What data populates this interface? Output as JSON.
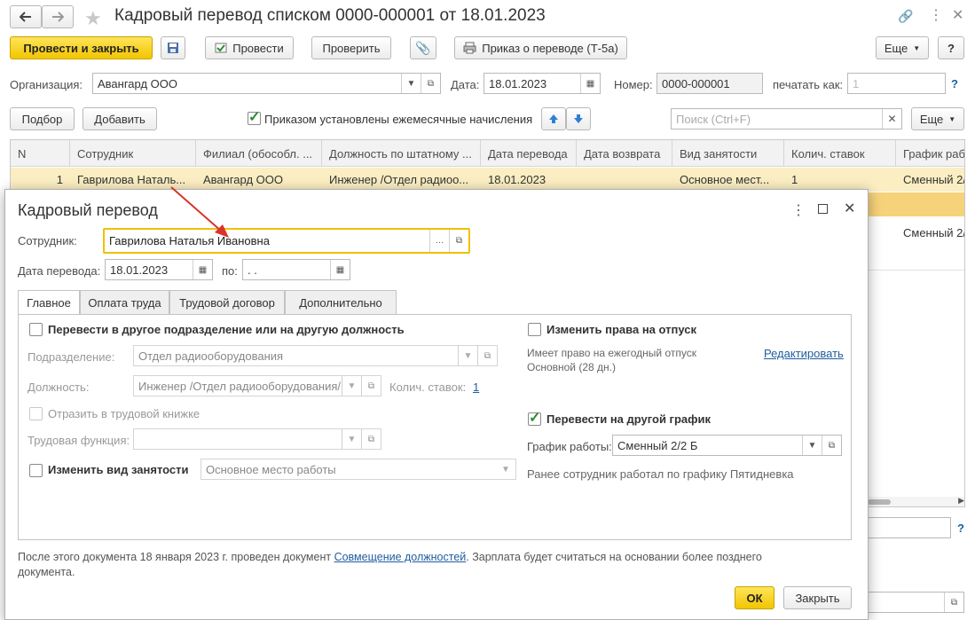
{
  "window": {
    "title": "Кадровый перевод списком 0000-000001 от 18.01.2023"
  },
  "toolbar": {
    "post_close": "Провести и закрыть",
    "post": "Провести",
    "check": "Проверить",
    "order": "Приказ о переводе (Т-5а)",
    "more": "Еще",
    "help": "?"
  },
  "header_fields": {
    "org_label": "Организация:",
    "org_value": "Авангард ООО",
    "date_label": "Дата:",
    "date_value": "18.01.2023",
    "number_label": "Номер:",
    "number_value": "0000-000001",
    "print_label": "печатать как:",
    "print_placeholder": "1",
    "help": "?"
  },
  "list_toolbar": {
    "select": "Подбор",
    "add": "Добавить",
    "monthly_label": "Приказом установлены ежемесячные начисления",
    "search_placeholder": "Поиск (Ctrl+F)",
    "more": "Еще"
  },
  "table": {
    "columns": [
      "N",
      "Сотрудник",
      "Филиал (обособл. ...",
      "Должность по штатному ...",
      "Дата перевода",
      "Дата возврата",
      "Вид занятости",
      "Колич. ставок",
      "График рабо"
    ],
    "rows": [
      [
        "1",
        "Гаврилова Наталь...",
        "Авангард ООО",
        "Инженер /Отдел радиоо...",
        "18.01.2023",
        "",
        "Основное мест...",
        "1",
        "Сменный 2/"
      ]
    ],
    "extra_cell": "Сменный 2/",
    "side_help": "?"
  },
  "dialog": {
    "title": "Кадровый перевод",
    "employee_label": "Сотрудник:",
    "employee_value": "Гаврилова Наталья Ивановна",
    "transfer_date_label": "Дата перевода:",
    "transfer_date_value": "18.01.2023",
    "to_label": "по:",
    "to_value": " .  .",
    "tabs": [
      "Главное",
      "Оплата труда",
      "Трудовой договор",
      "Дополнительно"
    ],
    "main": {
      "transfer_dept_label": "Перевести в другое подразделение или на другую должность",
      "dept_label": "Подразделение:",
      "dept_value": "Отдел радиооборудования",
      "position_label": "Должность:",
      "position_value": "Инженер /Отдел радиооборудования/",
      "rates_label": "Колич. ставок:",
      "rates_value": "1",
      "workbook_label": "Отразить в трудовой книжке",
      "labor_function_label": "Трудовая функция:",
      "employment_type_label": "Изменить вид занятости",
      "employment_type_value": "Основное место работы",
      "vacation_label": "Изменить права на отпуск",
      "vacation_info1": "Имеет право на ежегодный отпуск",
      "vacation_info2": "Основной (28 дн.)",
      "edit_link": "Редактировать",
      "schedule_toggle_label": "Перевести на другой график",
      "schedule_label": "График работы:",
      "schedule_value": "Сменный 2/2 Б",
      "schedule_note": "Ранее сотрудник работал по графику Пятидневка"
    },
    "footer_note_1": "После этого документа 18 января 2023 г. проведен документ ",
    "footer_link": "Совмещение должностей",
    "footer_note_2": ". Зарплата будет считаться на основании более позднего",
    "footer_note_3": "документа.",
    "ok": "ОК",
    "close": "Закрыть"
  },
  "colors": {
    "accent_yellow": "#f5d000",
    "selected_row": "#fbeec2",
    "highlight_border": "#f0c000",
    "arrow_red": "#d8342a",
    "link": "#1f5d9e",
    "check_green": "#2e8b35"
  }
}
